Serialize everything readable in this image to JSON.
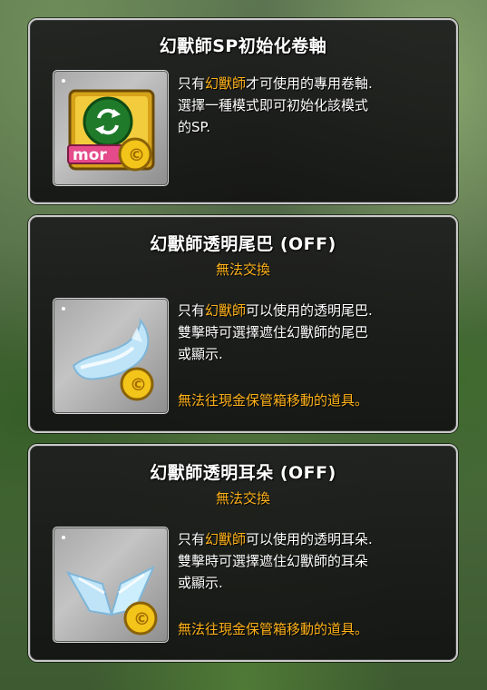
{
  "items": [
    {
      "title": "幻獸師SP初始化卷軸",
      "subtitle": "",
      "desc_prefix": "只有",
      "desc_highlight": "幻獸師",
      "desc_line1_rest": "才可使用的專用卷軸.",
      "desc_line2": "選擇一種模式即可初始化該模式",
      "desc_line3": "的SP.",
      "note": "",
      "icon": "sp-reset-scroll-icon"
    },
    {
      "title": "幻獸師透明尾巴 (OFF)",
      "subtitle": "無法交換",
      "desc_prefix": "只有",
      "desc_highlight": "幻獸師",
      "desc_line1_rest": "可以使用的透明尾巴.",
      "desc_line2": "雙擊時可選擇遮住幻獸師的尾巴",
      "desc_line3": "或顯示.",
      "note": "無法往現金保管箱移動的道具。",
      "icon": "transparent-tail-icon"
    },
    {
      "title": "幻獸師透明耳朵 (OFF)",
      "subtitle": "無法交換",
      "desc_prefix": "只有",
      "desc_highlight": "幻獸師",
      "desc_line1_rest": "可以使用的透明耳朵.",
      "desc_line2": "雙擊時可選擇遮住幻獸師的耳朵",
      "desc_line3": "或顯示.",
      "note": "無法往現金保管箱移動的道具。",
      "icon": "transparent-ears-icon"
    }
  ],
  "colors": {
    "highlight": "#ffb21a",
    "text": "#ffffff",
    "panel": "#1e1e1e"
  }
}
